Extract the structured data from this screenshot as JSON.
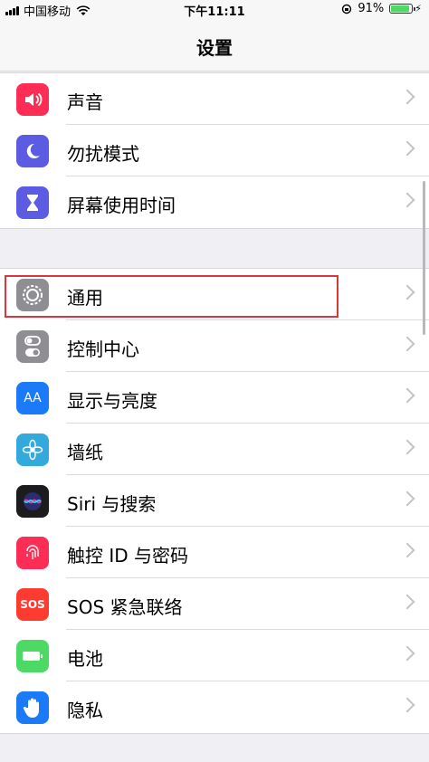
{
  "status": {
    "carrier": "中国移动",
    "time": "下午11:11",
    "battery": "91%",
    "battery_level": 0.91
  },
  "nav": {
    "title": "设置"
  },
  "group1": [
    {
      "label": "声音",
      "icon": "sound-icon",
      "color": "#fe2d55"
    },
    {
      "label": "勿扰模式",
      "icon": "moon-icon",
      "color": "#5b5ce2"
    },
    {
      "label": "屏幕使用时间",
      "icon": "hourglass-icon",
      "color": "#5b5ce2"
    }
  ],
  "group2": [
    {
      "label": "通用",
      "icon": "gear-icon",
      "color": "#8e8e93"
    },
    {
      "label": "控制中心",
      "icon": "toggle-icon",
      "color": "#8e8e93"
    },
    {
      "label": "显示与亮度",
      "icon": "text-size-icon",
      "icon_text": "AA",
      "color": "#1a7af8"
    },
    {
      "label": "墙纸",
      "icon": "flower-icon",
      "color": "#34aadc"
    },
    {
      "label": "Siri 与搜索",
      "icon": "siri-icon",
      "color": "#1c1c1e"
    },
    {
      "label": "触控 ID 与密码",
      "icon": "fingerprint-icon",
      "color": "#fe2d55"
    },
    {
      "label": "SOS 紧急联络",
      "icon": "sos-icon",
      "icon_text": "SOS",
      "color": "#fe3b30"
    },
    {
      "label": "电池",
      "icon": "battery-icon",
      "color": "#4cd964"
    },
    {
      "label": "隐私",
      "icon": "hand-icon",
      "color": "#1a7af8"
    }
  ]
}
